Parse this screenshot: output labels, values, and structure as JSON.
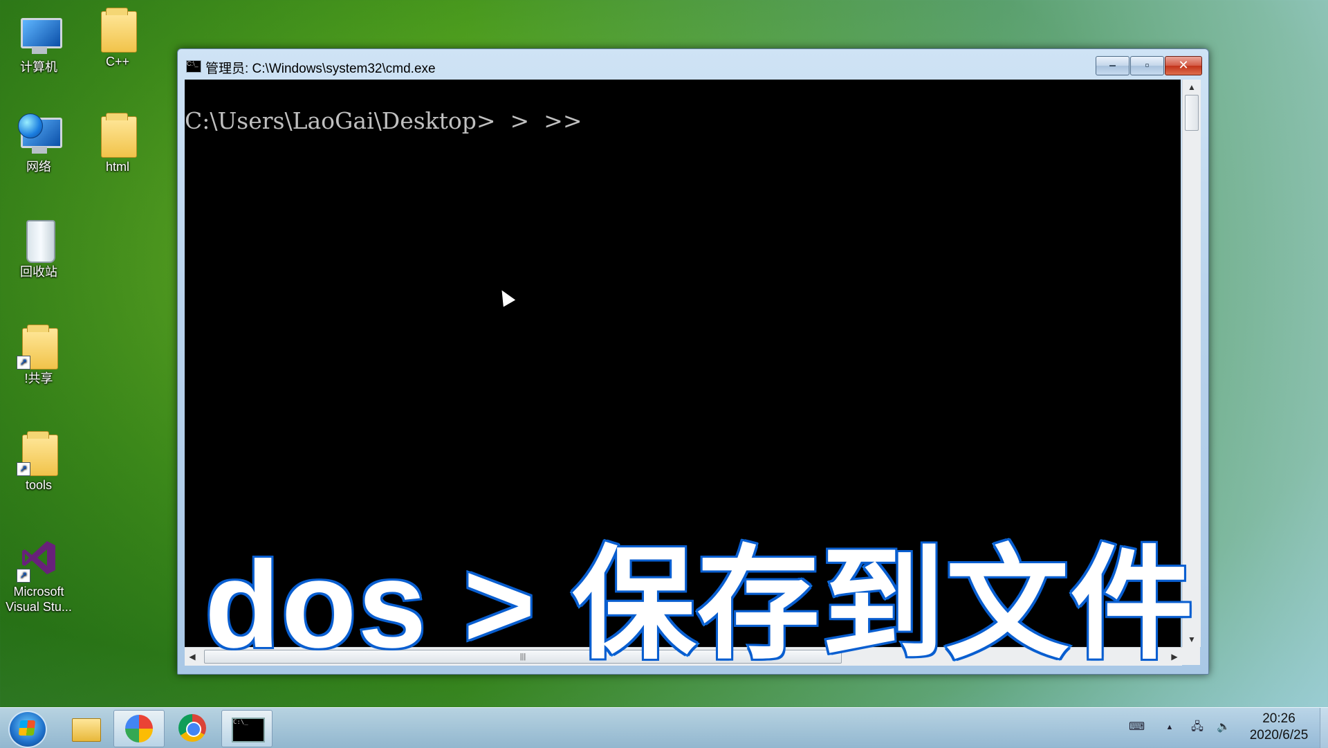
{
  "desktop": {
    "icons": [
      {
        "label": "计算机",
        "icon": "computer-icon"
      },
      {
        "label": "C++",
        "icon": "folder-icon"
      },
      {
        "label": "网络",
        "icon": "network-icon"
      },
      {
        "label": "html",
        "icon": "folder-icon"
      },
      {
        "label": "回收站",
        "icon": "recycle-bin-icon"
      },
      {
        "label": "!共享",
        "icon": "folder-shortcut-icon"
      },
      {
        "label": "tools",
        "icon": "folder-shortcut-icon"
      },
      {
        "label": "Microsoft",
        "label2": "Visual Stu...",
        "icon": "visual-studio-icon"
      }
    ]
  },
  "window": {
    "title": "管理员: C:\\Windows\\system32\\cmd.exe",
    "minimize_label": "–",
    "maximize_label": "▫",
    "close_label": "✕",
    "console_line": "C:\\Users\\LaoGai\\Desktop>  >  >>",
    "overlay_text": "dos > 保存到文件",
    "hscroll_grip": "|||"
  },
  "taskbar": {
    "items": [
      "explorer",
      "pinwheel",
      "chrome",
      "cmd"
    ],
    "clock_time": "20:26",
    "clock_date": "2020/6/25",
    "tray_arrow": "▲"
  },
  "colors": {
    "console_bg": "#000000",
    "console_text": "#c0c0c0",
    "overlay_stroke": "#1477e8",
    "close_button": "#c2331a"
  }
}
